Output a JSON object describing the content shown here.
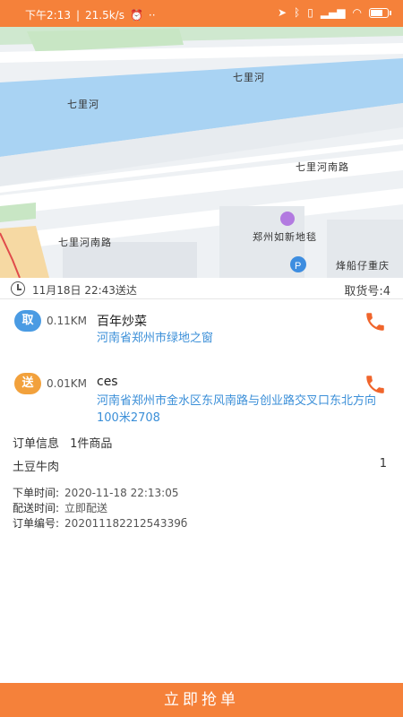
{
  "status_bar": {
    "time": "下午2:13",
    "net_speed": "21.5k/s",
    "battery": "78",
    "battery_level": 0.78
  },
  "map": {
    "labels": {
      "river_1": "七里河",
      "river_2": "七里河",
      "road_1": "七里河南路",
      "road_2": "七里河南路",
      "poi_1": "郑州如新地毯",
      "poi_2": "烽船仔重庆"
    }
  },
  "order": {
    "delivery_time": "11月18日 22:43送达",
    "pickup_code": "取货号:4",
    "pickup": {
      "badge": "取",
      "distance": "0.11KM",
      "name": "百年炒菜",
      "address": "河南省郑州市绿地之窗"
    },
    "dropoff": {
      "badge": "送",
      "distance": "0.01KM",
      "name": "ces",
      "address": "河南省郑州市金水区东风南路与创业路交叉口东北方向100米2708"
    },
    "info_label": "订单信息",
    "info_value": "1件商品",
    "item_name": "土豆牛肉",
    "item_qty": "1",
    "placed_label": "下单时间:",
    "placed_value": "2020-11-18 22:13:05",
    "delivery_label": "配送时间:",
    "delivery_value": "立即配送",
    "number_label": "订单编号:",
    "number_value": "20201118221254339б"
  },
  "grab_button": "立即抢单",
  "colors": {
    "accent": "#f5813a",
    "pickup_badge": "#4a9be3",
    "dropoff_badge": "#f2a13c",
    "address": "#3b8fd8"
  }
}
